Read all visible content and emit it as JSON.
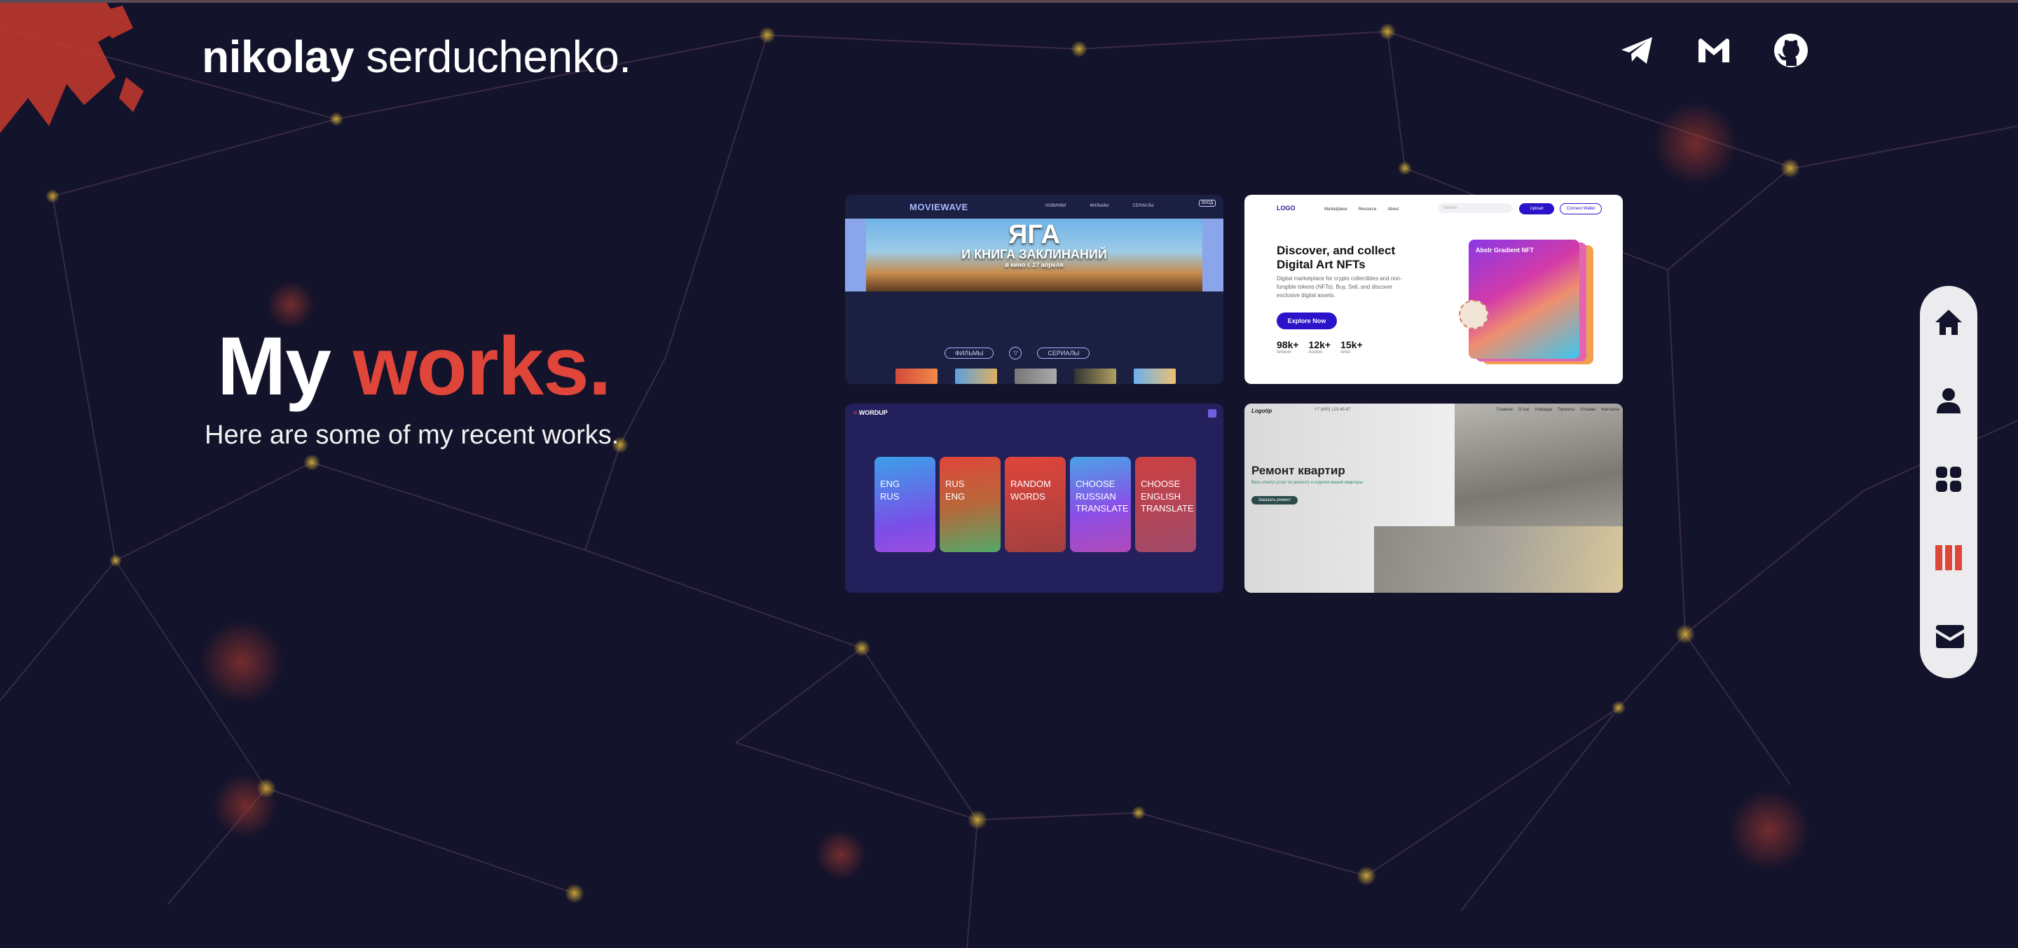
{
  "header": {
    "logo_first": "nikolay",
    "logo_last": "serduchenko."
  },
  "socials": [
    {
      "name": "telegram-icon"
    },
    {
      "name": "gmail-icon"
    },
    {
      "name": "github-icon"
    }
  ],
  "hero": {
    "title_part1": "My",
    "title_accent": "works.",
    "subtitle": "Here are some of my recent works."
  },
  "colors": {
    "background": "#13132b",
    "accent": "#e0453a",
    "dock": "#ececef"
  },
  "projects": {
    "moviewave": {
      "logo": "MOVIEWAVE",
      "nav": [
        "НОВИНКИ",
        "ФИЛЬМЫ",
        "СЕРИАЛЫ"
      ],
      "login": "ВХОД",
      "banner_line1": "ЯГА",
      "banner_line2": "И КНИГА ЗАКЛИНАНИЙ",
      "banner_line3": "в кино с 27 апреля",
      "tab1": "ФИЛЬМЫ",
      "tab2": "СЕРИАЛЫ",
      "tab_icon": "▽"
    },
    "nft": {
      "logo": "LOGO",
      "nav": [
        "Marketplace",
        "Resource",
        "About"
      ],
      "search_placeholder": "Search",
      "upload": "Upload",
      "connect": "Connect Wallet",
      "title_line1": "Discover, and collect",
      "title_line2": "Digital Art  NFTs",
      "description": "Digital marketplace for crypto collectibles and non-fungible tokens (NFTs). Buy, Sell, and discover exclusive digital assets.",
      "button": "Explore Now",
      "stats": [
        {
          "value": "98k+",
          "label": "Artwork"
        },
        {
          "value": "12k+",
          "label": "Auction"
        },
        {
          "value": "15k+",
          "label": "Artist"
        }
      ],
      "art_title": "Abstr Gradient NFT"
    },
    "wordup": {
      "logo_accent": "≡",
      "logo": "WORDUP",
      "cards": [
        {
          "line1": "ENG",
          "line2": "RUS",
          "line3": ""
        },
        {
          "line1": "RUS",
          "line2": "ENG",
          "line3": ""
        },
        {
          "line1": "RANDOM",
          "line2": "WORDS",
          "line3": ""
        },
        {
          "line1": "CHOOSE",
          "line2": "RUSSIAN",
          "line3": "TRANSLATE"
        },
        {
          "line1": "CHOOSE",
          "line2": "ENGLISH",
          "line3": "TRANSLATE"
        }
      ]
    },
    "remont": {
      "logo": "Logotip",
      "phone": "+7 (800) 123-45-67",
      "nav": [
        "Главная",
        "О нас",
        "Команда",
        "Проекты",
        "Отзывы",
        "Контакты"
      ],
      "title": "Ремонт квартир",
      "description": "Весь спектр услуг по ремонту и отделке вашей квартиры",
      "button": "Заказать ремонт"
    }
  },
  "dock": [
    {
      "name": "home-icon",
      "active": false
    },
    {
      "name": "user-icon",
      "active": false
    },
    {
      "name": "grid-icon",
      "active": false
    },
    {
      "name": "works-icon",
      "active": true
    },
    {
      "name": "mail-icon",
      "active": false
    }
  ]
}
